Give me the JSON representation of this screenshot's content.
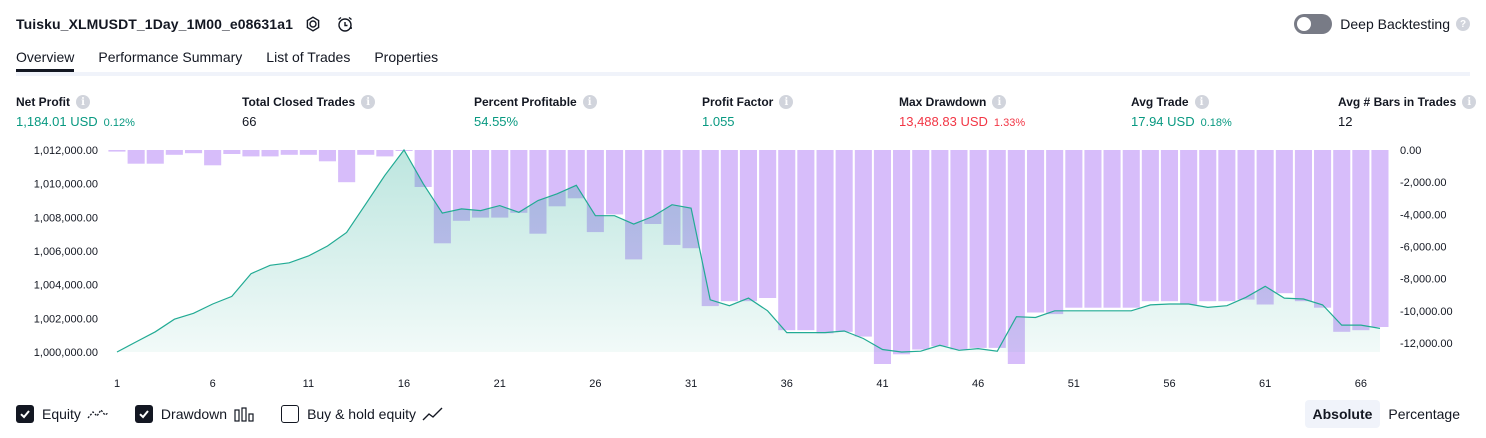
{
  "header": {
    "title": "Tuisku_XLMUSDT_1Day_1M00_e08631a1",
    "settings_icon": "gear-icon",
    "alert_icon": "alarm-clock-icon"
  },
  "deep_backtesting": {
    "label": "Deep Backtesting",
    "enabled": false
  },
  "tabs": [
    {
      "label": "Overview",
      "active": true
    },
    {
      "label": "Performance Summary",
      "active": false
    },
    {
      "label": "List of Trades",
      "active": false
    },
    {
      "label": "Properties",
      "active": false
    }
  ],
  "stats": [
    {
      "label": "Net Profit",
      "value": "1,184.01 USD",
      "pct": "0.12%",
      "color": "green"
    },
    {
      "label": "Total Closed Trades",
      "value": "66",
      "pct": "",
      "color": "black"
    },
    {
      "label": "Percent Profitable",
      "value": "54.55%",
      "pct": "",
      "color": "green"
    },
    {
      "label": "Profit Factor",
      "value": "1.055",
      "pct": "",
      "color": "green"
    },
    {
      "label": "Max Drawdown",
      "value": "13,488.83 USD",
      "pct": "1.33%",
      "color": "red"
    },
    {
      "label": "Avg Trade",
      "value": "17.94 USD",
      "pct": "0.18%",
      "color": "green"
    },
    {
      "label": "Avg # Bars in Trades",
      "value": "12",
      "pct": "",
      "color": "black"
    }
  ],
  "chart_data": {
    "type": "line",
    "left_axis": {
      "ticks": [
        "1,012,000.00",
        "1,010,000.00",
        "1,008,000.00",
        "1,006,000.00",
        "1,004,000.00",
        "1,002,000.00",
        "1,000,000.00"
      ],
      "min": 1000000,
      "max": 1012000
    },
    "right_axis": {
      "ticks": [
        "0.00",
        "-2,000.00",
        "-4,000.00",
        "-6,000.00",
        "-8,000.00",
        "-10,000.00",
        "-12,000.00"
      ],
      "min": -13300,
      "max": 0
    },
    "x_ticks": [
      "1",
      "6",
      "11",
      "16",
      "21",
      "26",
      "31",
      "36",
      "41",
      "46",
      "51",
      "56",
      "61",
      "66"
    ],
    "x_range": [
      1,
      67
    ],
    "series": [
      {
        "name": "Equity",
        "color": "#22ab94",
        "x": [
          1,
          2,
          3,
          4,
          5,
          6,
          7,
          8,
          9,
          10,
          11,
          12,
          13,
          14,
          15,
          16,
          17,
          18,
          19,
          20,
          21,
          22,
          23,
          24,
          25,
          26,
          27,
          28,
          29,
          30,
          31,
          32,
          33,
          34,
          35,
          36,
          37,
          38,
          39,
          40,
          41,
          42,
          43,
          44,
          45,
          46,
          47,
          48,
          49,
          50,
          51,
          52,
          53,
          54,
          55,
          56,
          57,
          58,
          59,
          60,
          61,
          62,
          63,
          64,
          65,
          66,
          67
        ],
        "values": [
          1000000,
          1000600,
          1001200,
          1001950,
          1002300,
          1002850,
          1003300,
          1004650,
          1005150,
          1005300,
          1005700,
          1006300,
          1007100,
          1008800,
          1010500,
          1012000,
          1010000,
          1008250,
          1008500,
          1008400,
          1008700,
          1008300,
          1009000,
          1009400,
          1009900,
          1008100,
          1008100,
          1007600,
          1008050,
          1008750,
          1008550,
          1003100,
          1002750,
          1003200,
          1002450,
          1001150,
          1001150,
          1001150,
          1001250,
          1000800,
          1000150,
          999800,
          1000050,
          1000400,
          1000100,
          1000200,
          1000050,
          1002100,
          1002050,
          1002450,
          1002450,
          1002450,
          1002450,
          1002450,
          1002800,
          1002850,
          1002850,
          1002650,
          1002750,
          1003250,
          1003900,
          1003200,
          1003150,
          1002800,
          1001600,
          1001600,
          1001400
        ]
      },
      {
        "name": "Drawdown",
        "color": "#d7bdfa",
        "values": [
          -100,
          -850,
          -850,
          -300,
          -200,
          -950,
          -250,
          -400,
          -400,
          -300,
          -300,
          -700,
          -2000,
          -300,
          -400,
          0,
          -2300,
          -5800,
          -4400,
          -4200,
          -4200,
          -3900,
          -5200,
          -3500,
          -3000,
          -5100,
          -4000,
          -6800,
          -4600,
          -5900,
          -6100,
          -9700,
          -9400,
          -9400,
          -9200,
          -11200,
          -11200,
          -11400,
          -11300,
          -11600,
          -13300,
          -12700,
          -12400,
          -12200,
          -12400,
          -12300,
          -12300,
          -13300,
          -10100,
          -10200,
          -9800,
          -9800,
          -9800,
          -9800,
          -9400,
          -9400,
          -9600,
          -9400,
          -9400,
          -9300,
          -9600,
          -8900,
          -9400,
          -9800,
          -11300,
          -11200,
          -11000
        ]
      }
    ],
    "legend": [
      {
        "label": "Equity",
        "checked": true,
        "icon": "equity-line-icon"
      },
      {
        "label": "Drawdown",
        "checked": true,
        "icon": "drawdown-bars-icon"
      },
      {
        "label": "Buy & hold equity",
        "checked": false,
        "icon": "buy-hold-line-icon"
      }
    ],
    "grid": false
  },
  "view_mode": {
    "options": [
      "Absolute",
      "Percentage"
    ],
    "selected": "Absolute"
  }
}
